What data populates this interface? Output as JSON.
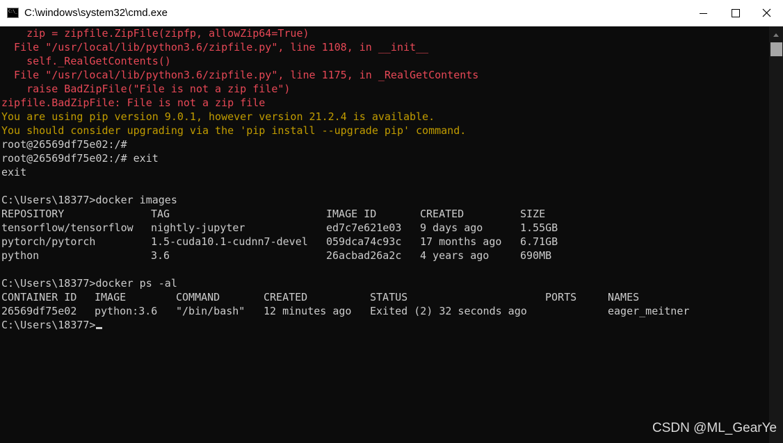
{
  "window": {
    "title": "C:\\windows\\system32\\cmd.exe",
    "icon": "cmd-icon",
    "icon_text": "C:\\_",
    "controls": [
      "minimize-icon",
      "maximize-icon",
      "close-icon"
    ]
  },
  "colors": {
    "background": "#0c0c0c",
    "text": "#cccccc",
    "error": "#e74856",
    "warning": "#c19c00"
  },
  "terminal": {
    "lines": {
      "l1": "    zip = zipfile.ZipFile(zipfp, allowZip64=True)",
      "l2": "  File \"/usr/local/lib/python3.6/zipfile.py\", line 1108, in __init__",
      "l3": "    self._RealGetContents()",
      "l4": "  File \"/usr/local/lib/python3.6/zipfile.py\", line 1175, in _RealGetContents",
      "l5": "    raise BadZipFile(\"File is not a zip file\")",
      "l6": "zipfile.BadZipFile: File is not a zip file",
      "l7": "You are using pip version 9.0.1, however version 21.2.4 is available.",
      "l8": "You should consider upgrading via the 'pip install --upgrade pip' command.",
      "l9": "root@26569df75e02:/#",
      "l10": "root@26569df75e02:/# exit",
      "l11": "exit",
      "l13": "C:\\Users\\18377>docker images",
      "l20": "C:\\Users\\18377>docker ps -al",
      "l23": "C:\\Users\\18377>"
    },
    "images_table": {
      "headers": [
        "REPOSITORY",
        "TAG",
        "IMAGE ID",
        "CREATED",
        "SIZE"
      ],
      "rows": [
        [
          "tensorflow/tensorflow",
          "nightly-jupyter",
          "ed7c7e621e03",
          "9 days ago",
          "1.55GB"
        ],
        [
          "pytorch/pytorch",
          "1.5-cuda10.1-cudnn7-devel",
          "059dca74c93c",
          "17 months ago",
          "6.71GB"
        ],
        [
          "python",
          "3.6",
          "26acbad26a2c",
          "4 years ago",
          "690MB"
        ]
      ]
    },
    "ps_table": {
      "headers": [
        "CONTAINER ID",
        "IMAGE",
        "COMMAND",
        "CREATED",
        "STATUS",
        "PORTS",
        "NAMES"
      ],
      "rows": [
        [
          "26569df75e02",
          "python:3.6",
          "\"/bin/bash\"",
          "12 minutes ago",
          "Exited (2) 32 seconds ago",
          "",
          "eager_meitner"
        ]
      ]
    }
  },
  "watermark": "CSDN @ML_GearYe"
}
